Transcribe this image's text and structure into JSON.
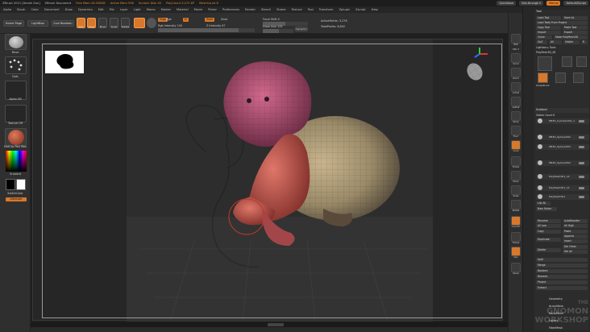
{
  "titlebar": {
    "app": "ZBrush 2021 [Daniel Zon]",
    "doc": "ZBrush Document",
    "stats": [
      "Free Mem 26.036GB",
      "Active Mem 938",
      "Scratch Disk 45",
      "PolyCount 3.272 KP",
      "MeshCount 8"
    ],
    "quicksave": "QuickSave",
    "see_through": "See-through 0",
    "menus": "Menus",
    "default_script": "DefaultZScript"
  },
  "menubar": [
    "Alpha",
    "Brush",
    "Color",
    "Document",
    "Draw",
    "Dynamics",
    "Edit",
    "File",
    "Layer",
    "Light",
    "Macro",
    "Marker",
    "Material",
    "Movie",
    "Picker",
    "Preferences",
    "Render",
    "Stencil",
    "Stroke",
    "Texture",
    "Tool",
    "Transform",
    "Zplugin",
    "Zscript",
    "Help"
  ],
  "shelf": {
    "home": "Home Page",
    "lightbox": "LightBox",
    "live_boolean": "Live Boolean",
    "tools": [
      "Edit",
      "Draw",
      "Move",
      "Scale",
      "Rotate"
    ],
    "mrgb": "Mrgb",
    "rgb": "Rgb",
    "m": "M",
    "zadd": "Zadd",
    "zsub": "Zsub",
    "rgb_intensity": "Rgb Intensity 100",
    "z_intensity": "Z Intensity 67",
    "focal_shift": "Focal Shift 0",
    "draw_size": "Draw Size 129",
    "dynamic": "Dynamic",
    "active_points": "ActivePoints: 3,276",
    "total_points": "TotalPoints: 6,802"
  },
  "leftshelf": {
    "brush": "Move",
    "stroke": "Dots",
    "alpha": "Alpha Off",
    "texture": "Texture Off",
    "material": "MatCap Red Wax",
    "gradient": "Gradient",
    "switch_color": "SwitchColor",
    "alternate": "Alternate"
  },
  "rightshelf": [
    "BPR",
    "SPix 3",
    "Scroll",
    "Zoom",
    "Actual",
    "AAHalf",
    "Persp",
    "Floor",
    "Local",
    "Frame",
    "Move",
    "Scale",
    "Rotate",
    "Line Fill",
    "PolyF",
    "Transp",
    "Ghost",
    "Solo",
    "Xpose"
  ],
  "rpanel": {
    "title": "Tool",
    "load_tool": "Load Tool",
    "save_as": "Save As",
    "load_from_project": "Load Tools From Project",
    "copy_tool": "Copy Tool",
    "paste_tool": "Paste Tool",
    "import": "Import",
    "export": "Export",
    "clone": "Clone",
    "make_polymesh": "Make PolyMesh3D",
    "goz": "GoZ",
    "all": "All",
    "visible": "Visible",
    "r": "R",
    "lightbox_tools": "Lightbox ▸ Tools",
    "polymesh_label": "PolyMesh3D_48",
    "thumbs": [
      "PolyMesh3D",
      "Cylinder3D",
      "SimpleBrush",
      "PolyMesh3D",
      "PolyMesh3D"
    ],
    "subtool": "Subtool",
    "visible_count": "Visible Count 8",
    "subtools": [
      "PM3D_Cylinder3D1_1",
      "PM3D_Sphere3D2",
      "PM3D_Sphere3D3",
      "PM3D_Sphere3D4",
      "PolyMesh3D1_14",
      "PolyMesh3D1_15",
      "PolyMesh3D1"
    ],
    "list_all": "List All",
    "new_folder": "New Folder",
    "rename": "Rename",
    "auto_reorder": "AutoReorder",
    "all_low": "All Low",
    "all_high": "All High",
    "copy": "Copy",
    "paste": "Paste",
    "duplicate": "Duplicate",
    "append": "Append",
    "insert": "Insert",
    "delete": "Delete",
    "del_other": "Del Other",
    "del_all": "Del All",
    "split": "Split",
    "merge": "Merge",
    "boolean": "Boolean",
    "remesh": "Remesh",
    "project": "Project",
    "extract": "Extract",
    "geometry": "Geometry",
    "arraymesh": "ArrayMesh",
    "nanomesh": "NanoMesh",
    "layers": "Layers",
    "fibermesh": "FiberMesh"
  },
  "watermark": [
    "THE",
    "GNOMON",
    "WORKSHOP"
  ],
  "colors": {
    "accent": "#d9782a",
    "bg": "#2b2b2b",
    "panel": "#2c2c2c"
  }
}
